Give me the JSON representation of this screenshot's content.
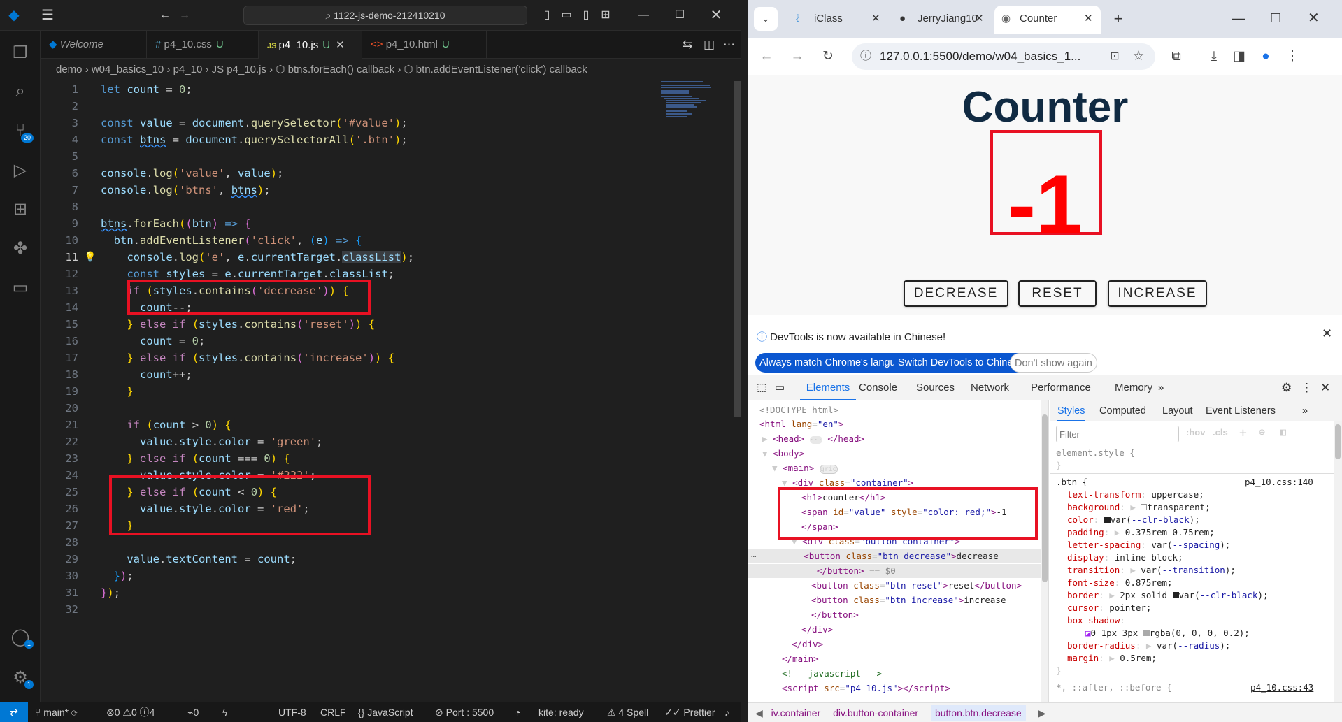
{
  "vscode": {
    "command_center": "1122-js-demo-212410210",
    "tabs": [
      {
        "label": "Welcome",
        "icon": "vscode-logo-icon",
        "badge": ""
      },
      {
        "label": "p4_10.css",
        "icon": "hash-icon",
        "badge": "U"
      },
      {
        "label": "p4_10.js",
        "icon": "js-icon",
        "badge": "U"
      },
      {
        "label": "p4_10.html",
        "icon": "html-icon",
        "badge": "U"
      }
    ],
    "breadcrumb": "demo  ›  w04_basics_10  ›  p4_10  ›  JS  p4_10.js  ›  ⬡ btns.forEach() callback  ›  ⬡ btn.addEventListener('click') callback",
    "activity_badges": {
      "scm": "20",
      "accounts": "1",
      "settings": "1"
    },
    "line_numbers": [
      "1",
      "2",
      "3",
      "4",
      "5",
      "6",
      "7",
      "8",
      "9",
      "10",
      "11",
      "12",
      "13",
      "14",
      "15",
      "16",
      "17",
      "18",
      "19",
      "20",
      "21",
      "22",
      "23",
      "24",
      "25",
      "26",
      "27",
      "28",
      "29",
      "30",
      "31",
      "32"
    ],
    "statusbar": {
      "branch": "main*",
      "errors": "0",
      "warnings": "0",
      "info": "4",
      "ports": "0",
      "encoding": "UTF-8",
      "eol": "CRLF",
      "language": "JavaScript",
      "port": "Port : 5500",
      "kite": "kite: ready",
      "spell": "4 Spell",
      "prettier": "Prettier"
    }
  },
  "chrome": {
    "tabs": [
      "iClass",
      "JerryJiang10",
      "Counter"
    ],
    "url": "127.0.0.1:5500/demo/w04_basics_1...",
    "page": {
      "title": "Counter",
      "value": "-1",
      "value_color": "#ff0000",
      "buttons": [
        "DECREASE",
        "RESET",
        "INCREASE"
      ]
    },
    "devtools": {
      "notice": "DevTools is now available in Chinese!",
      "notice_buttons": [
        "Always match Chrome's language",
        "Switch DevTools to Chinese",
        "Don't show again"
      ],
      "tabs": [
        "Elements",
        "Console",
        "Sources",
        "Network",
        "Performance",
        "Memory"
      ],
      "style_tabs": [
        "Styles",
        "Computed",
        "Layout",
        "Event Listeners"
      ],
      "filter_placeholder": "Filter",
      "hov": ":hov",
      "cls": ".cls",
      "css_source": "p4_10.css:140",
      "css_source2": "p4_10.css:43",
      "breadcrumb": [
        "iv.container",
        "div.button-container",
        "button.btn.decrease"
      ]
    }
  }
}
